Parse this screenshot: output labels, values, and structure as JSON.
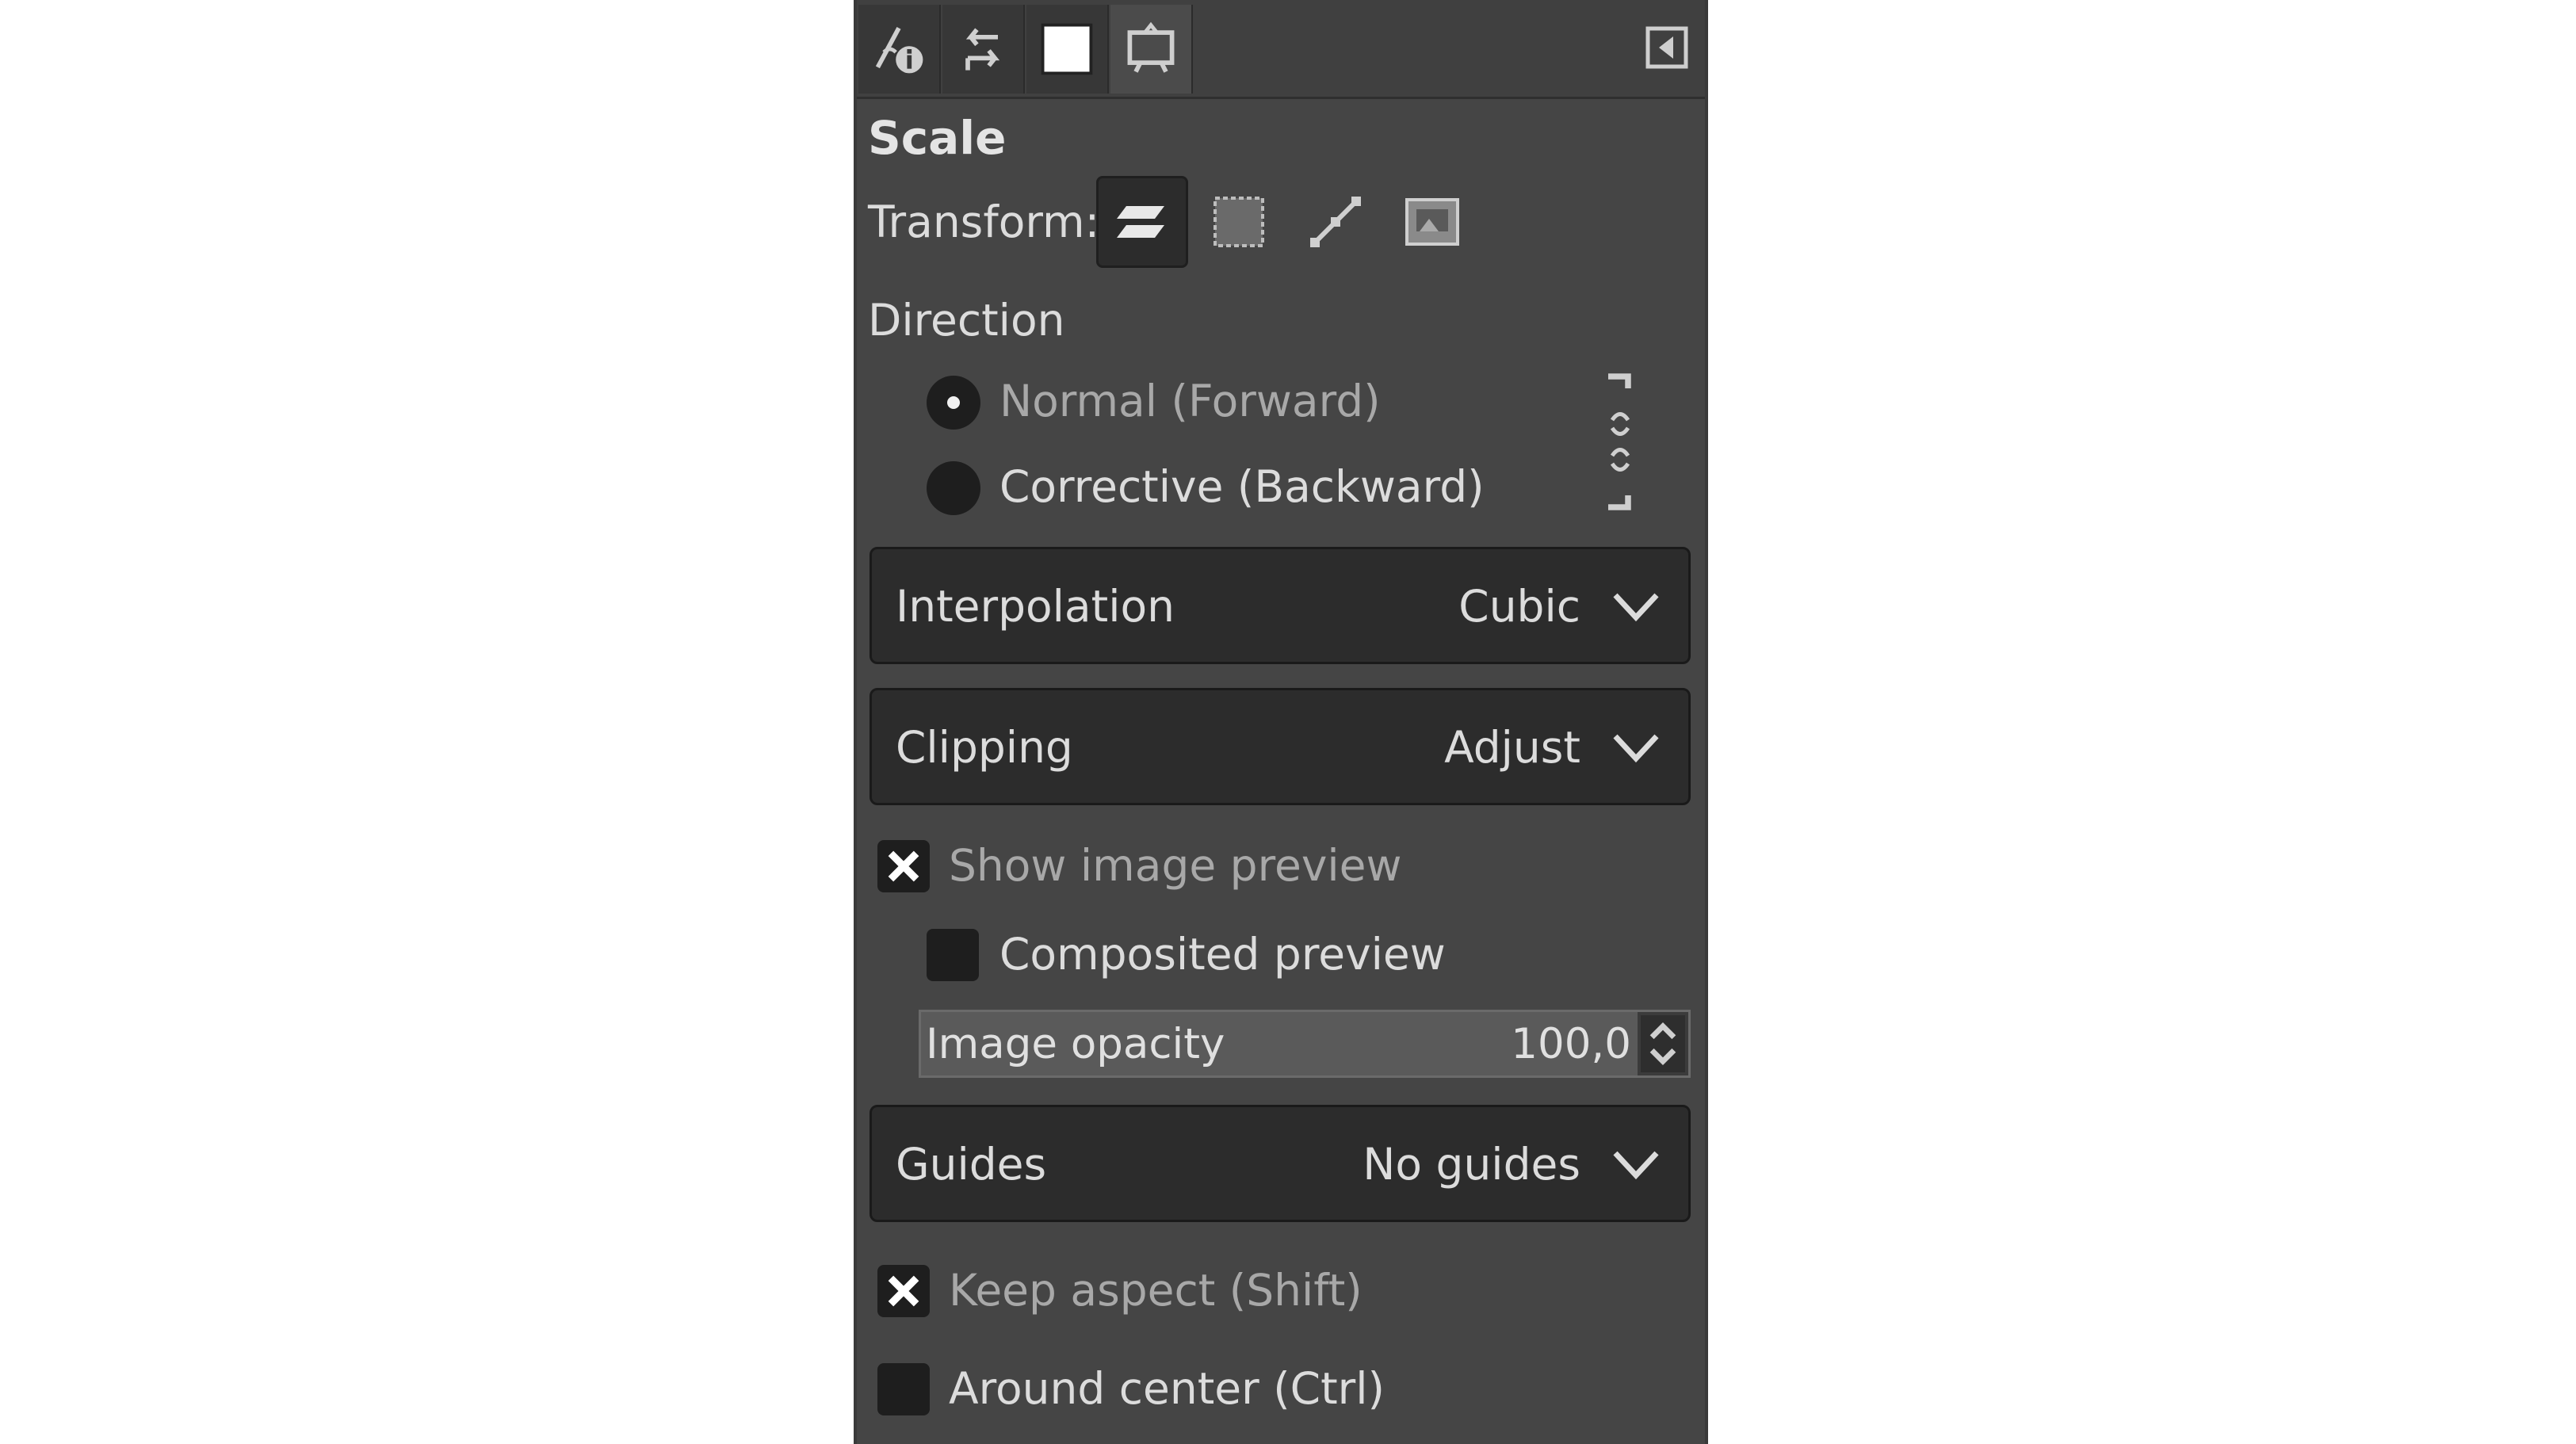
{
  "tabs": [
    {
      "name": "tool-options",
      "icon": "tool-options-icon",
      "active": false
    },
    {
      "name": "undo-history",
      "icon": "undo-history-icon",
      "active": false
    },
    {
      "name": "fg-bg-colors",
      "icon": "color-swatch-icon",
      "active": false
    },
    {
      "name": "images",
      "icon": "images-icon",
      "active": true
    }
  ],
  "tool": {
    "title": "Scale",
    "transform_label": "Transform:",
    "transform_modes": [
      "layer",
      "selection",
      "path",
      "image"
    ],
    "direction_label": "Direction",
    "direction_options": [
      "Normal (Forward)",
      "Corrective (Backward)"
    ],
    "direction_selected": 0
  },
  "interpolation": {
    "label": "Interpolation",
    "value": "Cubic"
  },
  "clipping": {
    "label": "Clipping",
    "value": "Adjust"
  },
  "preview": {
    "show_label": "Show image preview",
    "show_checked": true,
    "composited_label": "Composited preview",
    "composited_checked": false,
    "opacity_label": "Image opacity",
    "opacity_value": "100,0",
    "opacity_fraction": 1.0
  },
  "guides": {
    "label": "Guides",
    "value": "No guides"
  },
  "options": {
    "keep_aspect_label": "Keep aspect (Shift)",
    "keep_aspect_checked": true,
    "around_center_label": "Around center (Ctrl)",
    "around_center_checked": false
  },
  "colors": {
    "panel_bg": "#454545",
    "combo_bg": "#2c2c2c",
    "text": "#dcdcdc"
  }
}
